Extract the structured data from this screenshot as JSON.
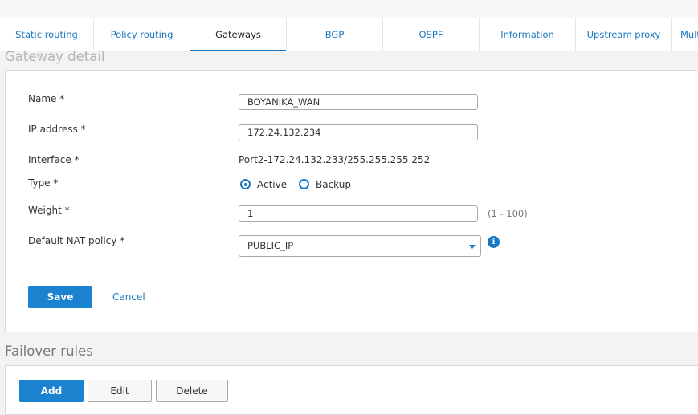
{
  "tabs": [
    {
      "label": "Static routing",
      "active": false
    },
    {
      "label": "Policy routing",
      "active": false
    },
    {
      "label": "Gateways",
      "active": true
    },
    {
      "label": "BGP",
      "active": false
    },
    {
      "label": "OSPF",
      "active": false
    },
    {
      "label": "Information",
      "active": false
    },
    {
      "label": "Upstream proxy",
      "active": false
    },
    {
      "label": "Mult",
      "active": false
    }
  ],
  "gateway_detail": {
    "title": "Gateway detail",
    "name_label": "Name *",
    "name_value": "BOYANIKA_WAN",
    "ip_label": "IP address *",
    "ip_value": "172.24.132.234",
    "interface_label": "Interface *",
    "interface_value": "Port2-172.24.132.233/255.255.255.252",
    "type_label": "Type *",
    "type_options": [
      "Active",
      "Backup"
    ],
    "type_selected": "Active",
    "weight_label": "Weight *",
    "weight_value": "1",
    "weight_hint": "(1 - 100)",
    "nat_label": "Default NAT policy *",
    "nat_value": "PUBLIC_IP",
    "save_label": "Save",
    "cancel_label": "Cancel"
  },
  "failover_rules": {
    "title": "Failover rules",
    "add_label": "Add",
    "edit_label": "Edit",
    "delete_label": "Delete"
  },
  "colors": {
    "accent": "#1a78c2",
    "primary_button": "#1a82cf"
  },
  "icons": {
    "info": "info-icon",
    "dropdown": "chevron-down-icon"
  }
}
